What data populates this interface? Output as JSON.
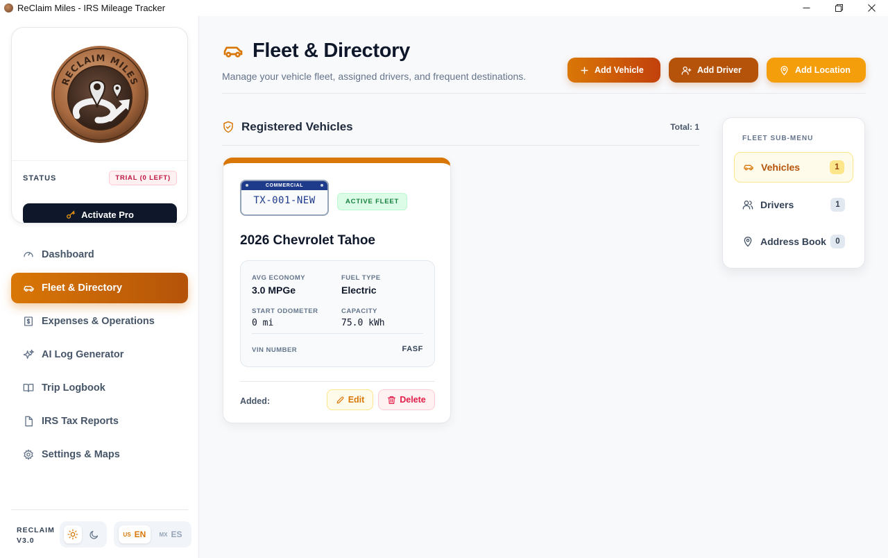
{
  "window": {
    "title": "ReClaim Miles - IRS Mileage Tracker",
    "controls": {
      "minimize": "—",
      "maximize": "❐",
      "close": "✕"
    }
  },
  "sidebar": {
    "logo": {
      "text": "RECLAIM MILES",
      "colors": {
        "ring": "#b0754a",
        "inner": "#5c4033"
      }
    },
    "status_label": "STATUS",
    "trial_badge": "TRIAL (0 LEFT)",
    "activate_label": "Activate Pro",
    "nav": [
      {
        "label": "Dashboard",
        "icon": "gauge-icon",
        "active": false
      },
      {
        "label": "Fleet & Directory",
        "icon": "car-icon",
        "active": true
      },
      {
        "label": "Expenses & Operations",
        "icon": "receipt-icon",
        "active": false
      },
      {
        "label": "AI Log Generator",
        "icon": "sparkles-icon",
        "active": false
      },
      {
        "label": "Trip Logbook",
        "icon": "book-icon",
        "active": false
      },
      {
        "label": "IRS Tax Reports",
        "icon": "file-icon",
        "active": false
      },
      {
        "label": "Settings & Maps",
        "icon": "gear-icon",
        "active": false
      }
    ],
    "version_line1": "RECLAIM",
    "version_line2": "V3.0",
    "theme": {
      "selected": "light"
    },
    "lang": {
      "en": {
        "flag": "US",
        "label": "EN",
        "selected": true
      },
      "es": {
        "flag": "MX",
        "label": "ES",
        "selected": false
      }
    }
  },
  "header": {
    "title": "Fleet & Directory",
    "subtitle": "Manage your vehicle fleet, assigned drivers, and frequent destinations.",
    "actions": {
      "add_vehicle": "Add Vehicle",
      "add_driver": "Add Driver",
      "add_location": "Add Location"
    }
  },
  "vehicles_section": {
    "title": "Registered Vehicles",
    "total": "Total: 1",
    "cards": [
      {
        "plate_header": "COMMERCIAL",
        "plate_number": "TX-001-NEW",
        "status_badge": "ACTIVE FLEET",
        "name": "2026 Chevrolet Tahoe",
        "avg_economy_label": "AVG ECONOMY",
        "avg_economy": "3.0 MPGe",
        "fuel_type_label": "FUEL TYPE",
        "fuel_type": "Electric",
        "start_odometer_label": "START ODOMETER",
        "start_odometer": "0 mi",
        "capacity_label": "CAPACITY",
        "capacity": "75.0 kWh",
        "vin_label": "VIN NUMBER",
        "vin": "FASF",
        "added_label": "Added:",
        "edit_label": "Edit",
        "delete_label": "Delete"
      }
    ]
  },
  "submenu": {
    "title": "FLEET SUB-MENU",
    "items": [
      {
        "label": "Vehicles",
        "count": "1",
        "icon": "car-icon",
        "active": true
      },
      {
        "label": "Drivers",
        "count": "1",
        "icon": "users-icon",
        "active": false
      },
      {
        "label": "Address Book",
        "count": "0",
        "icon": "map-pin-icon",
        "active": false
      }
    ]
  },
  "colors": {
    "accent": "#d97706",
    "accent_dark": "#b45309",
    "accent_light": "#f59e0b",
    "navy": "#0f172a",
    "success": "#15803d",
    "danger": "#e11d48"
  }
}
